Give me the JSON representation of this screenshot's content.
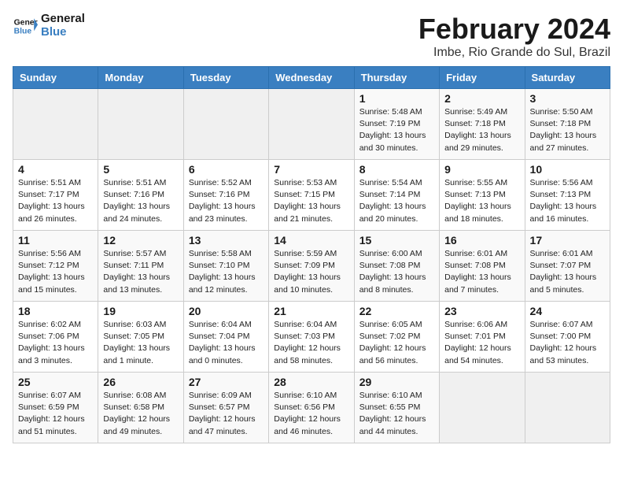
{
  "header": {
    "logo_general": "General",
    "logo_blue": "Blue",
    "title": "February 2024",
    "subtitle": "Imbe, Rio Grande do Sul, Brazil"
  },
  "weekdays": [
    "Sunday",
    "Monday",
    "Tuesday",
    "Wednesday",
    "Thursday",
    "Friday",
    "Saturday"
  ],
  "weeks": [
    [
      {
        "day": "",
        "info": ""
      },
      {
        "day": "",
        "info": ""
      },
      {
        "day": "",
        "info": ""
      },
      {
        "day": "",
        "info": ""
      },
      {
        "day": "1",
        "info": "Sunrise: 5:48 AM\nSunset: 7:19 PM\nDaylight: 13 hours\nand 30 minutes."
      },
      {
        "day": "2",
        "info": "Sunrise: 5:49 AM\nSunset: 7:18 PM\nDaylight: 13 hours\nand 29 minutes."
      },
      {
        "day": "3",
        "info": "Sunrise: 5:50 AM\nSunset: 7:18 PM\nDaylight: 13 hours\nand 27 minutes."
      }
    ],
    [
      {
        "day": "4",
        "info": "Sunrise: 5:51 AM\nSunset: 7:17 PM\nDaylight: 13 hours\nand 26 minutes."
      },
      {
        "day": "5",
        "info": "Sunrise: 5:51 AM\nSunset: 7:16 PM\nDaylight: 13 hours\nand 24 minutes."
      },
      {
        "day": "6",
        "info": "Sunrise: 5:52 AM\nSunset: 7:16 PM\nDaylight: 13 hours\nand 23 minutes."
      },
      {
        "day": "7",
        "info": "Sunrise: 5:53 AM\nSunset: 7:15 PM\nDaylight: 13 hours\nand 21 minutes."
      },
      {
        "day": "8",
        "info": "Sunrise: 5:54 AM\nSunset: 7:14 PM\nDaylight: 13 hours\nand 20 minutes."
      },
      {
        "day": "9",
        "info": "Sunrise: 5:55 AM\nSunset: 7:13 PM\nDaylight: 13 hours\nand 18 minutes."
      },
      {
        "day": "10",
        "info": "Sunrise: 5:56 AM\nSunset: 7:13 PM\nDaylight: 13 hours\nand 16 minutes."
      }
    ],
    [
      {
        "day": "11",
        "info": "Sunrise: 5:56 AM\nSunset: 7:12 PM\nDaylight: 13 hours\nand 15 minutes."
      },
      {
        "day": "12",
        "info": "Sunrise: 5:57 AM\nSunset: 7:11 PM\nDaylight: 13 hours\nand 13 minutes."
      },
      {
        "day": "13",
        "info": "Sunrise: 5:58 AM\nSunset: 7:10 PM\nDaylight: 13 hours\nand 12 minutes."
      },
      {
        "day": "14",
        "info": "Sunrise: 5:59 AM\nSunset: 7:09 PM\nDaylight: 13 hours\nand 10 minutes."
      },
      {
        "day": "15",
        "info": "Sunrise: 6:00 AM\nSunset: 7:08 PM\nDaylight: 13 hours\nand 8 minutes."
      },
      {
        "day": "16",
        "info": "Sunrise: 6:01 AM\nSunset: 7:08 PM\nDaylight: 13 hours\nand 7 minutes."
      },
      {
        "day": "17",
        "info": "Sunrise: 6:01 AM\nSunset: 7:07 PM\nDaylight: 13 hours\nand 5 minutes."
      }
    ],
    [
      {
        "day": "18",
        "info": "Sunrise: 6:02 AM\nSunset: 7:06 PM\nDaylight: 13 hours\nand 3 minutes."
      },
      {
        "day": "19",
        "info": "Sunrise: 6:03 AM\nSunset: 7:05 PM\nDaylight: 13 hours\nand 1 minute."
      },
      {
        "day": "20",
        "info": "Sunrise: 6:04 AM\nSunset: 7:04 PM\nDaylight: 13 hours\nand 0 minutes."
      },
      {
        "day": "21",
        "info": "Sunrise: 6:04 AM\nSunset: 7:03 PM\nDaylight: 12 hours\nand 58 minutes."
      },
      {
        "day": "22",
        "info": "Sunrise: 6:05 AM\nSunset: 7:02 PM\nDaylight: 12 hours\nand 56 minutes."
      },
      {
        "day": "23",
        "info": "Sunrise: 6:06 AM\nSunset: 7:01 PM\nDaylight: 12 hours\nand 54 minutes."
      },
      {
        "day": "24",
        "info": "Sunrise: 6:07 AM\nSunset: 7:00 PM\nDaylight: 12 hours\nand 53 minutes."
      }
    ],
    [
      {
        "day": "25",
        "info": "Sunrise: 6:07 AM\nSunset: 6:59 PM\nDaylight: 12 hours\nand 51 minutes."
      },
      {
        "day": "26",
        "info": "Sunrise: 6:08 AM\nSunset: 6:58 PM\nDaylight: 12 hours\nand 49 minutes."
      },
      {
        "day": "27",
        "info": "Sunrise: 6:09 AM\nSunset: 6:57 PM\nDaylight: 12 hours\nand 47 minutes."
      },
      {
        "day": "28",
        "info": "Sunrise: 6:10 AM\nSunset: 6:56 PM\nDaylight: 12 hours\nand 46 minutes."
      },
      {
        "day": "29",
        "info": "Sunrise: 6:10 AM\nSunset: 6:55 PM\nDaylight: 12 hours\nand 44 minutes."
      },
      {
        "day": "",
        "info": ""
      },
      {
        "day": "",
        "info": ""
      }
    ]
  ]
}
